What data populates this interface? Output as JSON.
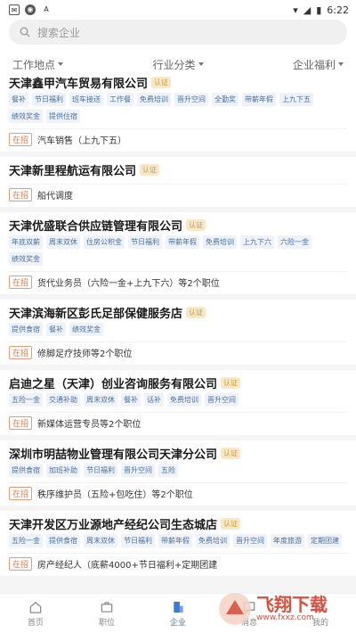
{
  "status": {
    "time": "6:22",
    "left_icons": [
      "notification-icon",
      "gallery-icon",
      "a-icon"
    ]
  },
  "search": {
    "placeholder": "搜索企业"
  },
  "filters": [
    "工作地点",
    "行业分类",
    "企业福利"
  ],
  "companies": [
    {
      "name": "天津鑫甲汽车贸易有限公司",
      "badge": "认证",
      "tags": [
        "餐补",
        "节日福利",
        "班车接送",
        "工作餐",
        "免费培训",
        "晋升空间",
        "全勤奖",
        "带薪年假",
        "上九下五",
        "绩效奖金",
        "提供住宿"
      ],
      "status": "在招",
      "job": "汽车销售（上九下五）"
    },
    {
      "name": "天津新里程航运有限公司",
      "badge": "认证",
      "tags": [],
      "status": "在招",
      "job": "船代调度"
    },
    {
      "name": "天津优盛联合供应链管理有限公司",
      "badge": "认证",
      "tags": [
        "年底双薪",
        "周末双休",
        "住房公积金",
        "节日福利",
        "带薪年假",
        "免费培训",
        "上九下六",
        "六险一金",
        "绩效奖金"
      ],
      "status": "在招",
      "job": "货代业务员（六险一金+上九下六）等2个职位"
    },
    {
      "name": "天津滨海新区彭氏足部保健服务店",
      "badge": "认证",
      "tags": [
        "提供食宿",
        "餐补",
        "绩效奖金"
      ],
      "status": "在招",
      "job": "修脚足疗技师等2个职位"
    },
    {
      "name": "启迪之星（天津）创业咨询服务有限公司",
      "badge": "认证",
      "tags": [
        "五险一金",
        "交通补助",
        "周末双休",
        "餐补",
        "话补",
        "免费培训",
        "晋升空间"
      ],
      "status": "在招",
      "job": "新媒体运营专员等2个职位"
    },
    {
      "name": "深圳市明喆物业管理有限公司天津分公司",
      "badge": "认证",
      "tags": [
        "提供食宿",
        "加班补助",
        "节日福利",
        "晋升空间",
        "五险"
      ],
      "status": "在招",
      "job": "秩序维护员（五险+包吃住）等2个职位"
    },
    {
      "name": "天津开发区万业源地产经纪公司生态城店",
      "badge": "认证",
      "tags": [
        "五险一金",
        "提供食宿",
        "周末双休",
        "节日福利",
        "带薪年假",
        "免费培训",
        "晋升空间",
        "年度旅游",
        "定期团建"
      ],
      "status": "在招",
      "job": "房产经纪人（底薪4000+节日福利+定期团建"
    }
  ],
  "tabbar": [
    {
      "label": "首页",
      "icon": "home-icon"
    },
    {
      "label": "职位",
      "icon": "briefcase-icon"
    },
    {
      "label": "企业",
      "icon": "building-icon",
      "active": true
    },
    {
      "label": "消息",
      "icon": "message-icon"
    },
    {
      "label": "我的",
      "icon": "user-icon"
    }
  ],
  "watermark": {
    "text": "飞翔下载",
    "sub": "www.fxxz.com"
  },
  "colors": {
    "accent": "#3c78d8",
    "badge_bg": "#f6e8c8",
    "badge_fg": "#c89a3c",
    "tag_bg": "#eef3fb",
    "tag_fg": "#4d6f9e",
    "hiring": "#e0764a"
  }
}
